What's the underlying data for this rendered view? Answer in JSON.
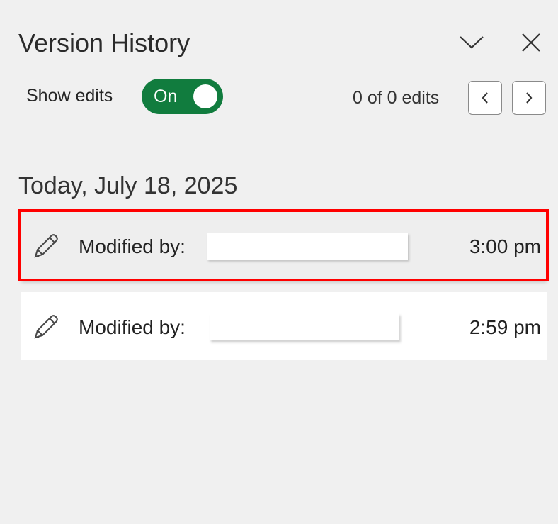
{
  "panel": {
    "title": "Version History"
  },
  "controls": {
    "show_edits_label": "Show edits",
    "toggle_label": "On",
    "toggle_on": true,
    "edit_count": "0 of 0 edits"
  },
  "history": {
    "date_heading": "Today, July 18, 2025",
    "entries": [
      {
        "label": "Modified by:",
        "time": "3:00 pm",
        "selected": true
      },
      {
        "label": "Modified by:",
        "time": "2:59 pm",
        "selected": false
      }
    ]
  },
  "colors": {
    "toggle": "#117c3e",
    "highlight": "#ff0000"
  }
}
